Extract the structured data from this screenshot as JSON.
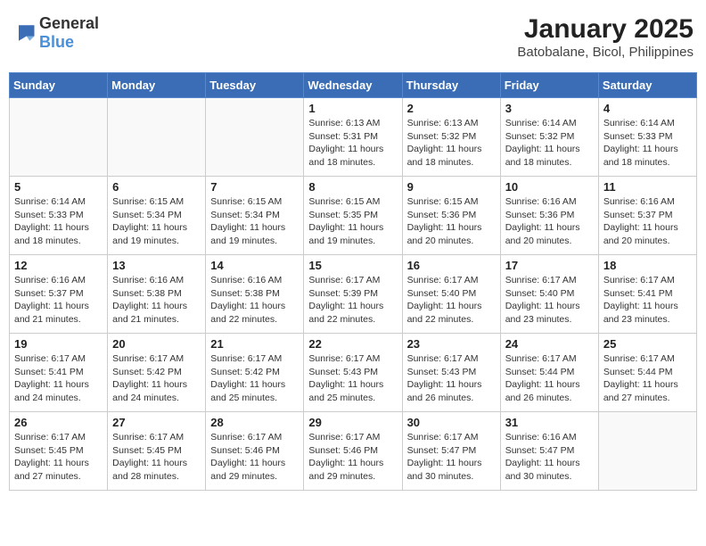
{
  "header": {
    "logo_general": "General",
    "logo_blue": "Blue",
    "title": "January 2025",
    "subtitle": "Batobalane, Bicol, Philippines"
  },
  "weekdays": [
    "Sunday",
    "Monday",
    "Tuesday",
    "Wednesday",
    "Thursday",
    "Friday",
    "Saturday"
  ],
  "weeks": [
    [
      {
        "day": "",
        "text": ""
      },
      {
        "day": "",
        "text": ""
      },
      {
        "day": "",
        "text": ""
      },
      {
        "day": "1",
        "text": "Sunrise: 6:13 AM\nSunset: 5:31 PM\nDaylight: 11 hours and 18 minutes."
      },
      {
        "day": "2",
        "text": "Sunrise: 6:13 AM\nSunset: 5:32 PM\nDaylight: 11 hours and 18 minutes."
      },
      {
        "day": "3",
        "text": "Sunrise: 6:14 AM\nSunset: 5:32 PM\nDaylight: 11 hours and 18 minutes."
      },
      {
        "day": "4",
        "text": "Sunrise: 6:14 AM\nSunset: 5:33 PM\nDaylight: 11 hours and 18 minutes."
      }
    ],
    [
      {
        "day": "5",
        "text": "Sunrise: 6:14 AM\nSunset: 5:33 PM\nDaylight: 11 hours and 18 minutes."
      },
      {
        "day": "6",
        "text": "Sunrise: 6:15 AM\nSunset: 5:34 PM\nDaylight: 11 hours and 19 minutes."
      },
      {
        "day": "7",
        "text": "Sunrise: 6:15 AM\nSunset: 5:34 PM\nDaylight: 11 hours and 19 minutes."
      },
      {
        "day": "8",
        "text": "Sunrise: 6:15 AM\nSunset: 5:35 PM\nDaylight: 11 hours and 19 minutes."
      },
      {
        "day": "9",
        "text": "Sunrise: 6:15 AM\nSunset: 5:36 PM\nDaylight: 11 hours and 20 minutes."
      },
      {
        "day": "10",
        "text": "Sunrise: 6:16 AM\nSunset: 5:36 PM\nDaylight: 11 hours and 20 minutes."
      },
      {
        "day": "11",
        "text": "Sunrise: 6:16 AM\nSunset: 5:37 PM\nDaylight: 11 hours and 20 minutes."
      }
    ],
    [
      {
        "day": "12",
        "text": "Sunrise: 6:16 AM\nSunset: 5:37 PM\nDaylight: 11 hours and 21 minutes."
      },
      {
        "day": "13",
        "text": "Sunrise: 6:16 AM\nSunset: 5:38 PM\nDaylight: 11 hours and 21 minutes."
      },
      {
        "day": "14",
        "text": "Sunrise: 6:16 AM\nSunset: 5:38 PM\nDaylight: 11 hours and 22 minutes."
      },
      {
        "day": "15",
        "text": "Sunrise: 6:17 AM\nSunset: 5:39 PM\nDaylight: 11 hours and 22 minutes."
      },
      {
        "day": "16",
        "text": "Sunrise: 6:17 AM\nSunset: 5:40 PM\nDaylight: 11 hours and 22 minutes."
      },
      {
        "day": "17",
        "text": "Sunrise: 6:17 AM\nSunset: 5:40 PM\nDaylight: 11 hours and 23 minutes."
      },
      {
        "day": "18",
        "text": "Sunrise: 6:17 AM\nSunset: 5:41 PM\nDaylight: 11 hours and 23 minutes."
      }
    ],
    [
      {
        "day": "19",
        "text": "Sunrise: 6:17 AM\nSunset: 5:41 PM\nDaylight: 11 hours and 24 minutes."
      },
      {
        "day": "20",
        "text": "Sunrise: 6:17 AM\nSunset: 5:42 PM\nDaylight: 11 hours and 24 minutes."
      },
      {
        "day": "21",
        "text": "Sunrise: 6:17 AM\nSunset: 5:42 PM\nDaylight: 11 hours and 25 minutes."
      },
      {
        "day": "22",
        "text": "Sunrise: 6:17 AM\nSunset: 5:43 PM\nDaylight: 11 hours and 25 minutes."
      },
      {
        "day": "23",
        "text": "Sunrise: 6:17 AM\nSunset: 5:43 PM\nDaylight: 11 hours and 26 minutes."
      },
      {
        "day": "24",
        "text": "Sunrise: 6:17 AM\nSunset: 5:44 PM\nDaylight: 11 hours and 26 minutes."
      },
      {
        "day": "25",
        "text": "Sunrise: 6:17 AM\nSunset: 5:44 PM\nDaylight: 11 hours and 27 minutes."
      }
    ],
    [
      {
        "day": "26",
        "text": "Sunrise: 6:17 AM\nSunset: 5:45 PM\nDaylight: 11 hours and 27 minutes."
      },
      {
        "day": "27",
        "text": "Sunrise: 6:17 AM\nSunset: 5:45 PM\nDaylight: 11 hours and 28 minutes."
      },
      {
        "day": "28",
        "text": "Sunrise: 6:17 AM\nSunset: 5:46 PM\nDaylight: 11 hours and 29 minutes."
      },
      {
        "day": "29",
        "text": "Sunrise: 6:17 AM\nSunset: 5:46 PM\nDaylight: 11 hours and 29 minutes."
      },
      {
        "day": "30",
        "text": "Sunrise: 6:17 AM\nSunset: 5:47 PM\nDaylight: 11 hours and 30 minutes."
      },
      {
        "day": "31",
        "text": "Sunrise: 6:16 AM\nSunset: 5:47 PM\nDaylight: 11 hours and 30 minutes."
      },
      {
        "day": "",
        "text": ""
      }
    ]
  ]
}
